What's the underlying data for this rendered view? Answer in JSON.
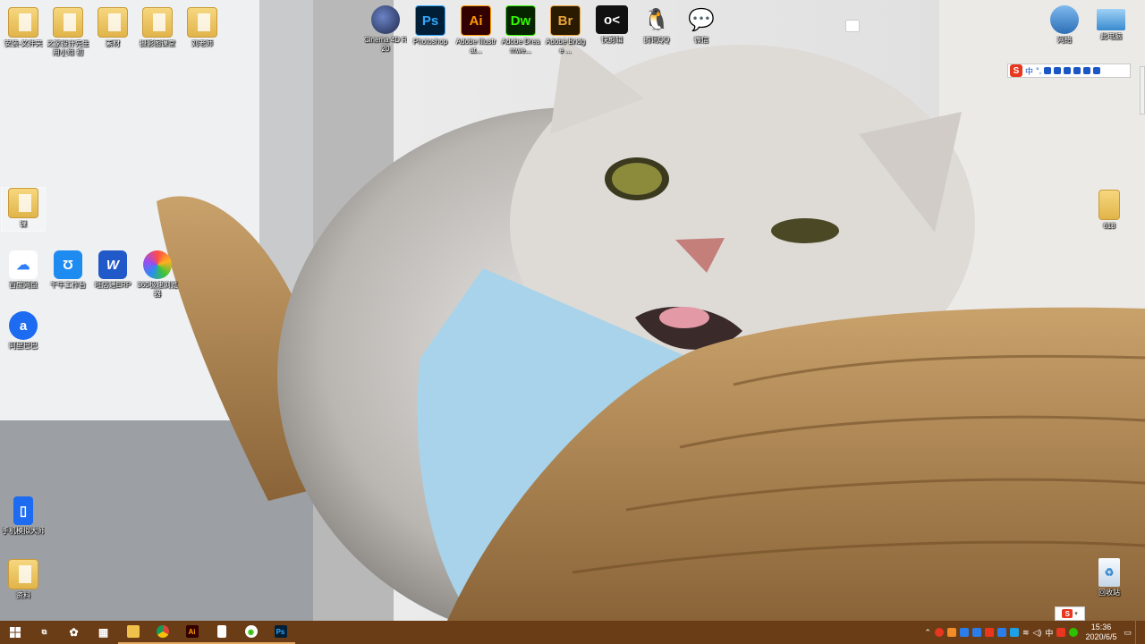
{
  "desktop": {
    "top_left_icons": [
      {
        "label": "安装-文件夹",
        "icon": "folder-icon"
      },
      {
        "label": "之家设计先生用小组 初级...",
        "icon": "folder-icon"
      },
      {
        "label": "素材",
        "icon": "folder-icon"
      },
      {
        "label": "摄影图课堂",
        "icon": "folder-icon"
      },
      {
        "label": "刘老师",
        "icon": "folder-icon"
      }
    ],
    "top_apps": [
      {
        "label": "Cinema 4D R20",
        "glyph": "",
        "color": "#1e2a4a"
      },
      {
        "label": "Photoshop",
        "glyph": "Ps",
        "color": "#001e36"
      },
      {
        "label": "Adobe Illustrat...",
        "glyph": "Ai",
        "color": "#330000"
      },
      {
        "label": "Adobe Dreamwe...",
        "glyph": "Dw",
        "color": "#072401"
      },
      {
        "label": "Adobe Bridge ...",
        "glyph": "Br",
        "color": "#2a1a00"
      },
      {
        "label": "快剪辑",
        "glyph": "o<",
        "color": "#111111"
      },
      {
        "label": "腾讯QQ",
        "glyph": "🐧",
        "color": "#ffffff"
      },
      {
        "label": "微信",
        "glyph": "💬",
        "color": "#ffffff"
      }
    ],
    "left_icons": [
      {
        "label": "课",
        "icon": "folder-icon"
      },
      {
        "label": "百度网盘",
        "icon": "baidu-netdisk-icon"
      },
      {
        "label": "千牛工作台",
        "icon": "qianniu-icon"
      },
      {
        "label": "旺店通ERP",
        "icon": "wangdiantong-icon"
      },
      {
        "label": "360极速浏览器",
        "icon": "360-browser-icon"
      },
      {
        "label": "阿里巴巴",
        "icon": "alibaba-icon"
      },
      {
        "label": "手机模拟大师",
        "icon": "phone-emulator-icon"
      },
      {
        "label": "资料",
        "icon": "folder-icon"
      }
    ],
    "right_icons": [
      {
        "label": "网络",
        "icon": "network-icon"
      },
      {
        "label": "此电脑",
        "icon": "this-pc-icon"
      },
      {
        "label": "618",
        "icon": "folder-icon"
      },
      {
        "label": "回收站",
        "icon": "recycle-bin-icon"
      }
    ]
  },
  "ime": {
    "logo": "S",
    "mode": "中",
    "punct": "°,"
  },
  "taskbar": {
    "apps": [
      {
        "name": "task-view",
        "glyph": "⧉"
      },
      {
        "name": "pinwheel",
        "glyph": "✿"
      },
      {
        "name": "calculator",
        "glyph": "▦"
      },
      {
        "name": "file-explorer",
        "glyph": "▬"
      },
      {
        "name": "chrome",
        "glyph": "●"
      },
      {
        "name": "illustrator",
        "glyph": "Ai"
      },
      {
        "name": "notepad",
        "glyph": "▯"
      },
      {
        "name": "wechat",
        "glyph": "◉"
      },
      {
        "name": "photoshop",
        "glyph": "Ps"
      }
    ],
    "tray_lang": "中",
    "time": "15:36",
    "date": "2020/6/5"
  }
}
